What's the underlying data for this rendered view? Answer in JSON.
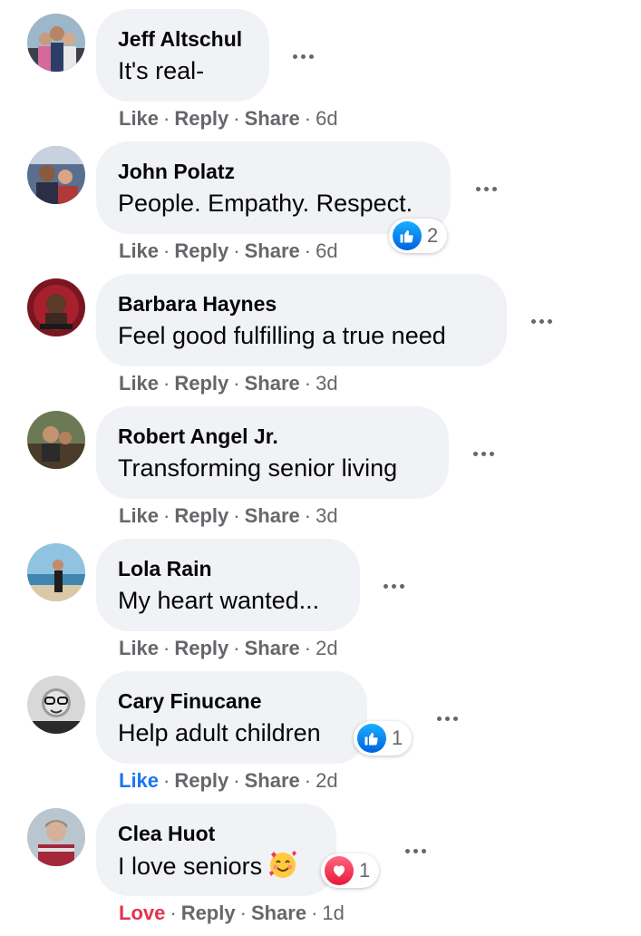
{
  "actions": {
    "like": "Like",
    "love": "Love",
    "reply": "Reply",
    "share": "Share",
    "dot": "·"
  },
  "comments": [
    {
      "author": "Jeff Altschul",
      "text": "It's real-",
      "age": "6d",
      "avatar": "photo-avatar"
    },
    {
      "author": "John Polatz",
      "text": "People. Empathy. Respect.",
      "age": "6d",
      "reaction_icon": "like-icon",
      "reaction_count": "2"
    },
    {
      "author": "Barbara Haynes",
      "text": "Feel good fulfilling a true need",
      "age": "3d"
    },
    {
      "author": "Robert Angel Jr.",
      "text": "Transforming senior living",
      "age": "3d"
    },
    {
      "author": "Lola Rain",
      "text": "My heart wanted...",
      "age": "2d"
    },
    {
      "author": "Cary Finucane",
      "text": "Help adult children",
      "age": "2d",
      "reaction_icon": "like-icon",
      "reaction_count": "1",
      "own_reaction": "Like"
    },
    {
      "author": "Clea Huot",
      "text": "I love seniors",
      "emoji": "smiling-face-with-hearts-emoji",
      "age": "1d",
      "reaction_icon": "love-icon",
      "reaction_count": "1",
      "own_reaction": "Love"
    }
  ],
  "colors": {
    "bubble": "#f0f2f5",
    "meta": "#65676b",
    "like_blue": "#1877f2",
    "love_red": "#e4334e"
  }
}
